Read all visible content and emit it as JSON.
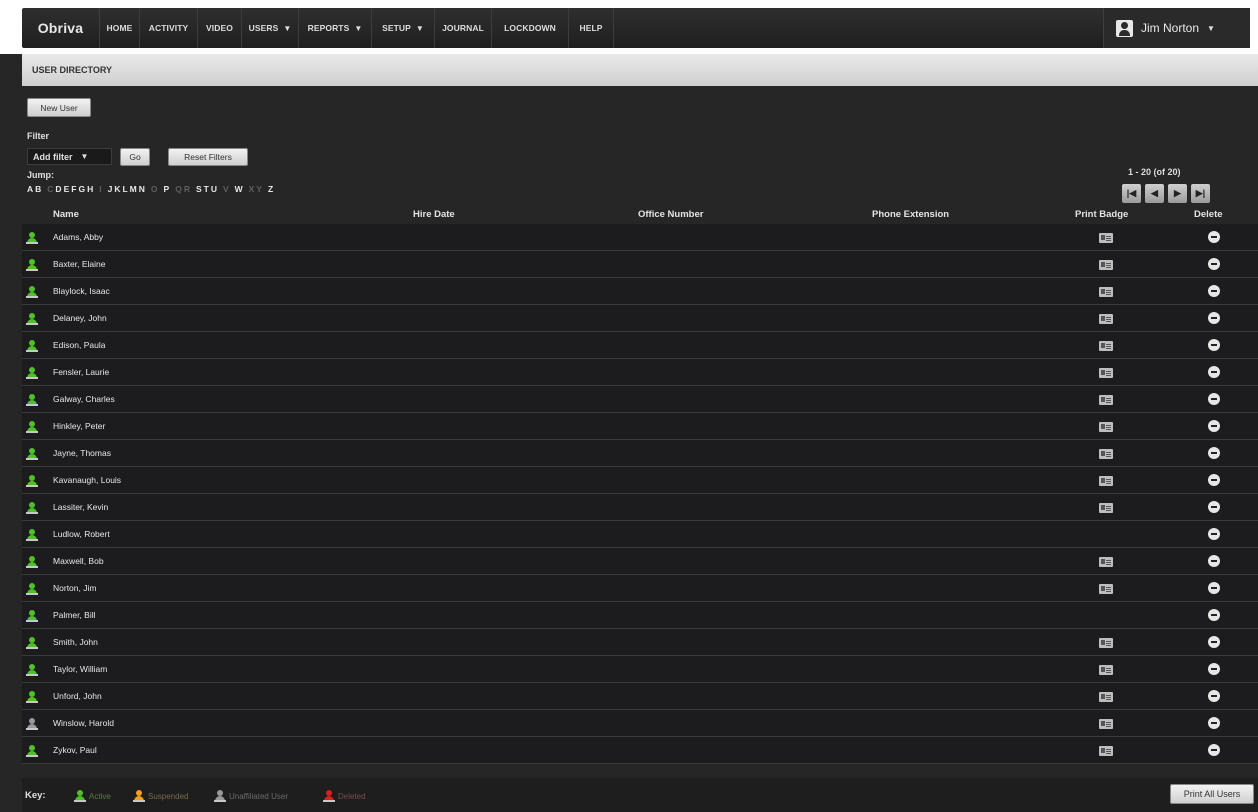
{
  "nav": {
    "logo": "Obriva",
    "items": [
      {
        "label": "HOME",
        "caret": false
      },
      {
        "label": "ACTIVITY",
        "caret": false
      },
      {
        "label": "VIDEO",
        "caret": false
      },
      {
        "label": "USERS",
        "caret": true
      },
      {
        "label": "REPORTS",
        "caret": true
      },
      {
        "label": "SETUP",
        "caret": true
      },
      {
        "label": "JOURNAL",
        "caret": false
      },
      {
        "label": "LOCKDOWN",
        "caret": false
      },
      {
        "label": "HELP",
        "caret": false
      }
    ],
    "user_name": "Jim Norton",
    "caret_glyph": "▼"
  },
  "page_title": "USER DIRECTORY",
  "toolbar": {
    "new_user_label": "New User",
    "filter_label": "Filter",
    "add_filter_label": "Add filter",
    "go_label": "Go",
    "reset_label": "Reset Filters",
    "jump_label": "Jump:"
  },
  "jump_letters": [
    {
      "l": "A",
      "on": true
    },
    {
      "l": "B",
      "on": true
    },
    {
      "l": "C",
      "on": false
    },
    {
      "l": "D",
      "on": true
    },
    {
      "l": "E",
      "on": true
    },
    {
      "l": "F",
      "on": true
    },
    {
      "l": "G",
      "on": true
    },
    {
      "l": "H",
      "on": true
    },
    {
      "l": "I",
      "on": false
    },
    {
      "l": "J",
      "on": true
    },
    {
      "l": "K",
      "on": true
    },
    {
      "l": "L",
      "on": true
    },
    {
      "l": "M",
      "on": true
    },
    {
      "l": "N",
      "on": true
    },
    {
      "l": "O",
      "on": false
    },
    {
      "l": "P",
      "on": true
    },
    {
      "l": "Q",
      "on": false
    },
    {
      "l": "R",
      "on": false
    },
    {
      "l": "S",
      "on": true
    },
    {
      "l": "T",
      "on": true
    },
    {
      "l": "U",
      "on": true
    },
    {
      "l": "V",
      "on": false
    },
    {
      "l": "W",
      "on": true
    },
    {
      "l": "X",
      "on": false
    },
    {
      "l": "Y",
      "on": false
    },
    {
      "l": "Z",
      "on": true
    }
  ],
  "pagination": {
    "range": "1 - 20 (of 20)",
    "first_glyph": "|◀",
    "prev_glyph": "◀",
    "next_glyph": "▶",
    "last_glyph": "▶|"
  },
  "columns": {
    "name": "Name",
    "hire_date": "Hire Date",
    "office": "Office Number",
    "phone": "Phone Extension",
    "badge": "Print Badge",
    "delete": "Delete"
  },
  "status_colors": {
    "active": "#4fbf2a",
    "suspended": "#f0a020",
    "unaffiliated": "#9a9a9a",
    "deleted": "#d82020"
  },
  "users": [
    {
      "name": "Adams, Abby",
      "status": "active",
      "badge": true
    },
    {
      "name": "Baxter, Elaine",
      "status": "active",
      "badge": true
    },
    {
      "name": "Blaylock, Isaac",
      "status": "active",
      "badge": true
    },
    {
      "name": "Delaney, John",
      "status": "active",
      "badge": true
    },
    {
      "name": "Edison, Paula",
      "status": "active",
      "badge": true
    },
    {
      "name": "Fensler, Laurie",
      "status": "active",
      "badge": true
    },
    {
      "name": "Galway, Charles",
      "status": "active",
      "badge": true
    },
    {
      "name": "Hinkley, Peter",
      "status": "active",
      "badge": true
    },
    {
      "name": "Jayne, Thomas",
      "status": "active",
      "badge": true
    },
    {
      "name": "Kavanaugh, Louis",
      "status": "active",
      "badge": true
    },
    {
      "name": "Lassiter, Kevin",
      "status": "active",
      "badge": true
    },
    {
      "name": "Ludlow, Robert",
      "status": "active",
      "badge": false
    },
    {
      "name": "Maxwell, Bob",
      "status": "active",
      "badge": true
    },
    {
      "name": "Norton, Jim",
      "status": "active",
      "badge": true
    },
    {
      "name": "Palmer, Bill",
      "status": "active",
      "badge": false
    },
    {
      "name": "Smith, John",
      "status": "active",
      "badge": true
    },
    {
      "name": "Taylor, William",
      "status": "active",
      "badge": true
    },
    {
      "name": "Unford, John",
      "status": "active",
      "badge": true
    },
    {
      "name": "Winslow, Harold",
      "status": "unaffiliated",
      "badge": true
    },
    {
      "name": "Zykov, Paul",
      "status": "active",
      "badge": true
    }
  ],
  "key": {
    "label": "Key:",
    "items": [
      {
        "label": "Active",
        "status": "active",
        "color": "#5a7a4a"
      },
      {
        "label": "Suspended",
        "status": "suspended",
        "color": "#7a6a4a"
      },
      {
        "label": "Unaffiliated User",
        "status": "unaffiliated",
        "color": "#6a6a6a"
      },
      {
        "label": "Deleted",
        "status": "deleted",
        "color": "#7a4a4a"
      }
    ]
  },
  "print_all_label": "Print All Users"
}
